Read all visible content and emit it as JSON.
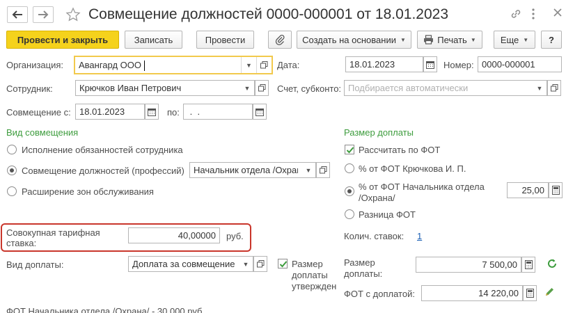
{
  "window": {
    "title": "Совмещение должностей 0000-000001 от 18.01.2023"
  },
  "toolbar": {
    "post_close": "Провести и закрыть",
    "write": "Записать",
    "post": "Провести",
    "create_based": "Создать на основании",
    "print": "Печать",
    "more": "Еще",
    "help": "?"
  },
  "form": {
    "org_label": "Организация:",
    "org_value": "Авангард ООО",
    "date_label": "Дата:",
    "date_value": "18.01.2023",
    "number_label": "Номер:",
    "number_value": "0000-000001",
    "employee_label": "Сотрудник:",
    "employee_value": "Крючков Иван Петрович",
    "account_label": "Счет, субконто:",
    "account_placeholder": "Подбирается автоматически",
    "from_label": "Совмещение с:",
    "from_value": "18.01.2023",
    "to_label": "по:",
    "to_value": " .  .",
    "type_heading": "Вид совмещения",
    "type_options": [
      "Исполнение обязанностей сотрудника",
      "Совмещение должностей (профессий)",
      "Расширение зон обслуживания"
    ],
    "type_selected_index": 1,
    "position_value": "Начальник отдела /Охрана/",
    "tariff_label_line1": "Совокупная тарифная",
    "tariff_label_line2": "ставка:",
    "tariff_value": "40,00000",
    "tariff_unit": "руб.",
    "payment_type_label": "Вид доплаты:",
    "payment_type_value": "Доплата за совмещение должностей",
    "approved_line1": "Размер",
    "approved_line2": "доплаты",
    "approved_line3": "утвержден",
    "approved_checked": true,
    "bottom_text": "ФОТ Начальника отдела /Охрана/ - 30 000 руб."
  },
  "surcharge": {
    "heading": "Размер доплаты",
    "calc_by_fot": "Рассчитать по ФОТ",
    "calc_by_fot_checked": true,
    "options": [
      "% от ФОТ Крючкова И. П.",
      "% от ФОТ Начальника отдела",
      "Разница ФОТ"
    ],
    "option2_line2": "/Охрана/",
    "selected_index": 1,
    "percent_value": "25,00",
    "rates_label": "Колич. ставок:",
    "rates_value": "1",
    "size_label_line1": "Размер",
    "size_label_line2": "доплаты:",
    "size_value": "7 500,00",
    "fot_label": "ФОТ с доплатой:",
    "fot_value": "14 220,00"
  },
  "colors": {
    "primary_button": "#f5d21c",
    "heading_green": "#3d9c3d",
    "highlight_red": "#c9362b",
    "focus_yellow": "#f2c94c",
    "link_blue": "#1a5fb4"
  },
  "icons": [
    "back-arrow-icon",
    "forward-arrow-icon",
    "star-icon",
    "link-icon",
    "kebab-menu-icon",
    "maximize-icon",
    "close-icon",
    "paperclip-icon",
    "printer-icon",
    "calendar-icon",
    "calculator-icon",
    "refresh-icon",
    "pencil-icon",
    "open-form-icon"
  ]
}
